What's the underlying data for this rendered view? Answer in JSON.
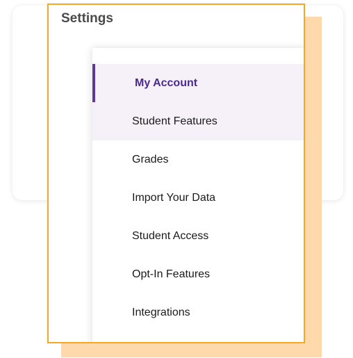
{
  "settings": {
    "title": "Settings"
  },
  "menu": {
    "items": [
      {
        "label": "My Account",
        "active": true
      },
      {
        "label": "Student Features"
      },
      {
        "label": "Grades"
      },
      {
        "label": "Import Your Data"
      },
      {
        "label": "Student Access"
      },
      {
        "label": "Opt-In Features"
      },
      {
        "label": "Integrations"
      }
    ]
  },
  "colors": {
    "accent": "#5b3a9a",
    "active_text": "#4b2a8f",
    "highlight_bg": "#f6f1f9",
    "frame_border": "#f5a623",
    "offset_shadow": "#fdd9ab"
  }
}
